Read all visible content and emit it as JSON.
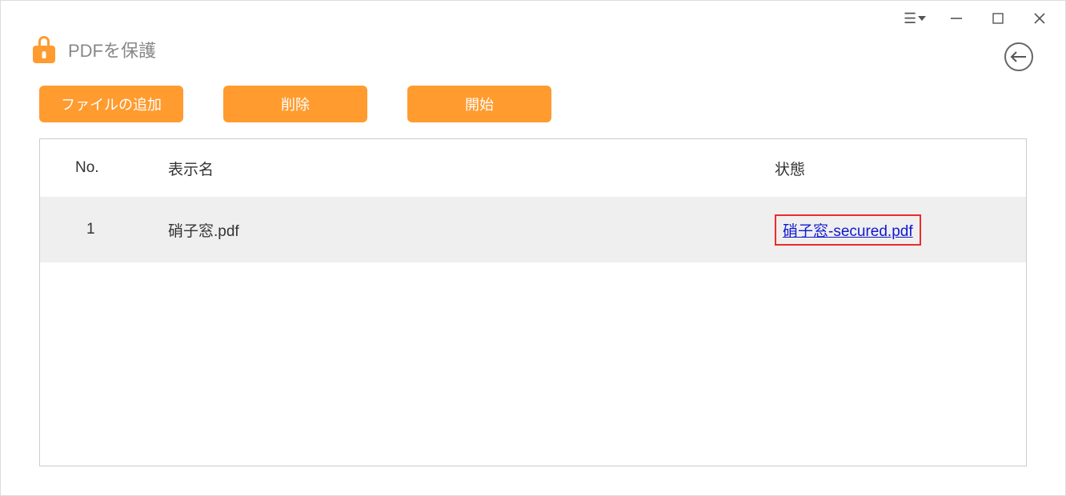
{
  "app": {
    "title": "PDFを保護"
  },
  "toolbar": {
    "add_label": "ファイルの追加",
    "delete_label": "削除",
    "start_label": "開始"
  },
  "table": {
    "headers": {
      "no": "No.",
      "name": "表示名",
      "status": "状態"
    },
    "rows": [
      {
        "no": "1",
        "name": "硝子窓.pdf",
        "status_link": "硝子窓-secured.pdf"
      }
    ]
  }
}
